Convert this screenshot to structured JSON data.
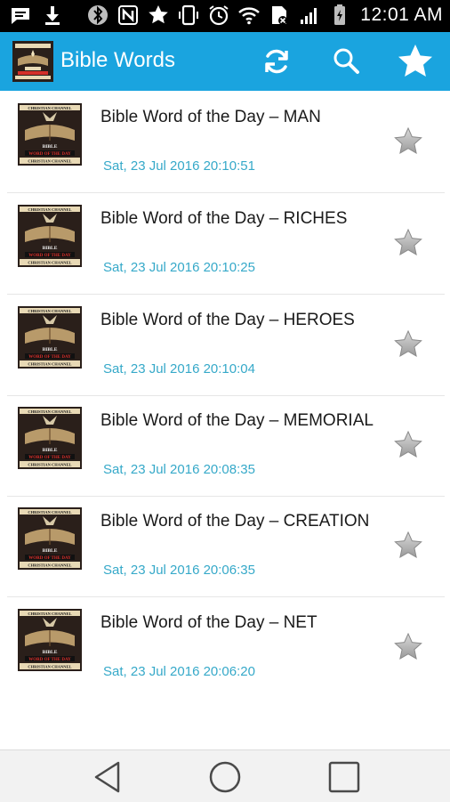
{
  "status_bar": {
    "time": "12:01 AM",
    "icons": [
      "message-icon",
      "download-icon",
      "bluetooth-icon",
      "nfc-icon",
      "star-icon",
      "vibrate-icon",
      "alarm-icon",
      "wifi-icon",
      "sim-icon",
      "signal-icon",
      "battery-charging-icon"
    ]
  },
  "action_bar": {
    "title": "Bible Words",
    "logo_icon": "bible-word-of-the-day-logo",
    "buttons": [
      "refresh-icon",
      "search-icon",
      "favorites-star-icon"
    ],
    "color": "#1aa4df"
  },
  "list": {
    "items": [
      {
        "title": "Bible Word of the Day – MAN",
        "date": "Sat, 23 Jul 2016 20:10:51"
      },
      {
        "title": "Bible Word of the Day – RICHES",
        "date": "Sat, 23 Jul 2016 20:10:25"
      },
      {
        "title": "Bible Word of the Day – HEROES",
        "date": "Sat, 23 Jul 2016 20:10:04"
      },
      {
        "title": "Bible Word of the Day – MEMORIAL",
        "date": "Sat, 23 Jul 2016 20:08:35"
      },
      {
        "title": "Bible Word of the Day – CREATION",
        "date": "Sat, 23 Jul 2016 20:06:35"
      },
      {
        "title": "Bible Word of the Day – NET",
        "date": "Sat, 23 Jul 2016 20:06:20"
      }
    ],
    "thumbnail": {
      "top_text": "CHRISTIAN CHANNEL",
      "middle_text": "BIBLE",
      "sub_text": "WORD OF THE DAY",
      "bottom_text": "CHRISTIAN CHANNEL"
    },
    "date_color": "#36a9c9"
  },
  "nav_bar": {
    "buttons": [
      "back-icon",
      "home-icon",
      "recents-icon"
    ]
  }
}
